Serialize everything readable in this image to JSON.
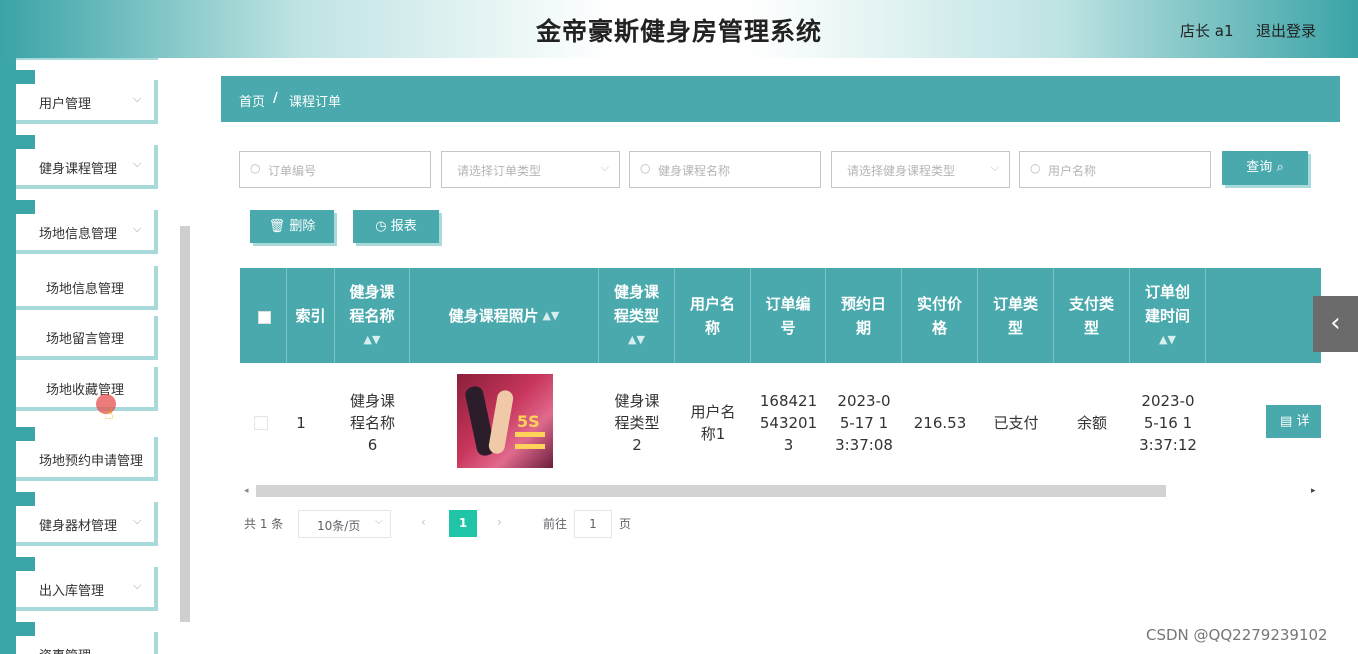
{
  "header": {
    "title": "金帝豪斯健身房管理系统",
    "user": "店长 a1",
    "logout": "退出登录"
  },
  "sidebar": {
    "menus": [
      {
        "label": "用户管理",
        "chev": "⌵"
      },
      {
        "label": "健身课程管理",
        "chev": "⌵"
      },
      {
        "label": "场地信息管理",
        "chev": "⌵"
      }
    ],
    "submenus": [
      "场地信息管理",
      "场地留言管理",
      "场地收藏管理"
    ],
    "menus2": [
      {
        "label": "场地预约申请管理"
      },
      {
        "label": "健身器材管理",
        "chev": "⌵"
      },
      {
        "label": "出入库管理",
        "chev": "⌵"
      },
      {
        "label": "资事管理"
      }
    ]
  },
  "breadcrumb": {
    "home": "首页",
    "sep": "/",
    "current": "课程订单"
  },
  "search": {
    "order_no": "订单编号",
    "order_type": "请选择订单类型",
    "course_name": "健身课程名称",
    "course_type": "请选择健身课程类型",
    "user_name": "用户名称",
    "query": "查询",
    "delete": "删除",
    "report": "报表"
  },
  "table": {
    "headers": [
      "索引",
      "健身课程名称",
      "健身课程照片",
      "健身课程类型",
      "用户名称",
      "订单编号",
      "预约日期",
      "实付价格",
      "订单类型",
      "支付类型",
      "订单创建时间"
    ],
    "rows": [
      {
        "index": "1",
        "course_name": "健身课程名称6",
        "photo_text": "5S",
        "course_type": "健身课程类型2",
        "user_name": "用户名称1",
        "order_no": "1684215432013",
        "booking_date": "2023-05-17 13:37:08",
        "price": "216.53",
        "order_type": "已支付",
        "pay_type": "余额",
        "created": "2023-05-16 13:37:12",
        "detail": "详情"
      }
    ]
  },
  "pagination": {
    "total": "共 1 条",
    "page_size": "10条/页",
    "current": "1",
    "goto": "前往",
    "goto_value": "1",
    "page_unit": "页"
  },
  "watermark": "CSDN @QQ2279239102",
  "colors": {
    "primary": "#49a9ad",
    "accent_light": "#a8dadb",
    "active_page": "#20c4a6"
  }
}
